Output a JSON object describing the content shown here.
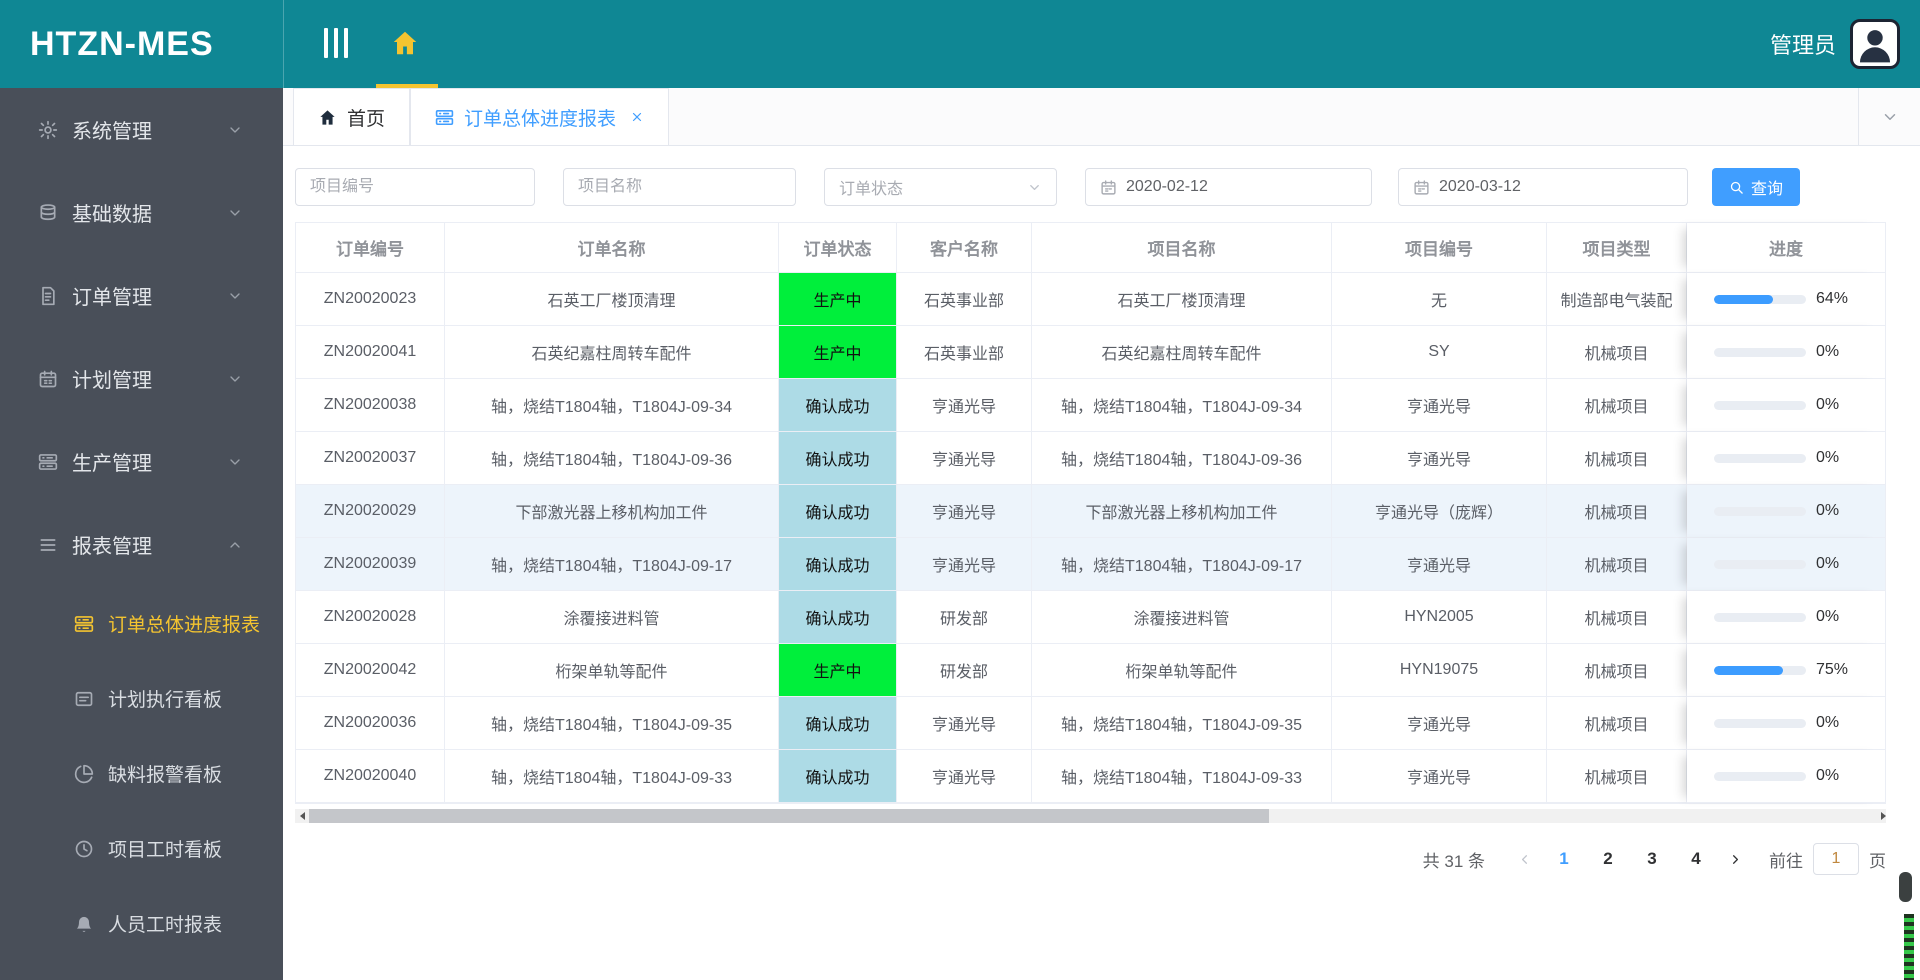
{
  "theme": {
    "teal": "#0f8794",
    "sidebar_bg": "#494f59",
    "accent_blue": "#409eff",
    "gold": "#f4c430",
    "status_green": "#00ef3b",
    "status_light_blue": "#addbe6",
    "progress_blue": "#3c9cff"
  },
  "header": {
    "logo": "HTZN-MES",
    "user": "管理员"
  },
  "sidebar": {
    "items": [
      {
        "label": "系统管理",
        "icon": "gear",
        "expanded": false
      },
      {
        "label": "基础数据",
        "icon": "database",
        "expanded": false
      },
      {
        "label": "订单管理",
        "icon": "document",
        "expanded": false
      },
      {
        "label": "计划管理",
        "icon": "calendar",
        "expanded": false
      },
      {
        "label": "生产管理",
        "icon": "server",
        "expanded": false
      },
      {
        "label": "报表管理",
        "icon": "list",
        "expanded": true
      }
    ],
    "submenu": [
      {
        "label": "订单总体进度报表",
        "icon": "server",
        "active": true
      },
      {
        "label": "计划执行看板",
        "icon": "board",
        "active": false
      },
      {
        "label": "缺料报警看板",
        "icon": "pie",
        "active": false
      },
      {
        "label": "项目工时看板",
        "icon": "clock",
        "active": false
      },
      {
        "label": "人员工时报表",
        "icon": "bell",
        "active": false
      }
    ]
  },
  "tabs": [
    {
      "label": "首页",
      "icon": "home",
      "active": false,
      "closable": false
    },
    {
      "label": "订单总体进度报表",
      "icon": "server",
      "active": true,
      "closable": true
    }
  ],
  "filters": {
    "project_no_placeholder": "项目编号",
    "project_name_placeholder": "项目名称",
    "order_status_placeholder": "订单状态",
    "date_from": "2020-02-12",
    "date_to": "2020-03-12",
    "search_label": "查询"
  },
  "table": {
    "columns": [
      "订单编号",
      "订单名称",
      "订单状态",
      "客户名称",
      "项目名称",
      "项目编号",
      "项目类型",
      "进度"
    ],
    "rows": [
      {
        "order_no": "ZN20020023",
        "order_name": "石英工厂楼顶清理",
        "status": "生产中",
        "status_type": "green",
        "customer": "石英事业部",
        "project_name": "石英工厂楼顶清理",
        "project_no": "无",
        "project_type": "制造部电气装配",
        "progress": 64,
        "highlight": false
      },
      {
        "order_no": "ZN20020041",
        "order_name": "石英纪嘉柱周转车配件",
        "status": "生产中",
        "status_type": "green",
        "customer": "石英事业部",
        "project_name": "石英纪嘉柱周转车配件",
        "project_no": "SY",
        "project_type": "机械项目",
        "progress": 0,
        "highlight": false
      },
      {
        "order_no": "ZN20020038",
        "order_name": "轴，烧结T1804轴，T1804J-09-34",
        "status": "确认成功",
        "status_type": "blue",
        "customer": "亨通光导",
        "project_name": "轴，烧结T1804轴，T1804J-09-34",
        "project_no": "亨通光导",
        "project_type": "机械项目",
        "progress": 0,
        "highlight": false
      },
      {
        "order_no": "ZN20020037",
        "order_name": "轴，烧结T1804轴，T1804J-09-36",
        "status": "确认成功",
        "status_type": "blue",
        "customer": "亨通光导",
        "project_name": "轴，烧结T1804轴，T1804J-09-36",
        "project_no": "亨通光导",
        "project_type": "机械项目",
        "progress": 0,
        "highlight": false
      },
      {
        "order_no": "ZN20020029",
        "order_name": "下部激光器上移机构加工件",
        "status": "确认成功",
        "status_type": "blue",
        "customer": "亨通光导",
        "project_name": "下部激光器上移机构加工件",
        "project_no": "亨通光导（庞辉）",
        "project_type": "机械项目",
        "progress": 0,
        "highlight": true
      },
      {
        "order_no": "ZN20020039",
        "order_name": "轴，烧结T1804轴，T1804J-09-17",
        "status": "确认成功",
        "status_type": "blue",
        "customer": "亨通光导",
        "project_name": "轴，烧结T1804轴，T1804J-09-17",
        "project_no": "亨通光导",
        "project_type": "机械项目",
        "progress": 0,
        "highlight": true
      },
      {
        "order_no": "ZN20020028",
        "order_name": "涂覆接进料管",
        "status": "确认成功",
        "status_type": "blue",
        "customer": "研发部",
        "project_name": "涂覆接进料管",
        "project_no": "HYN2005",
        "project_type": "机械项目",
        "progress": 0,
        "highlight": false
      },
      {
        "order_no": "ZN20020042",
        "order_name": "桁架单轨等配件",
        "status": "生产中",
        "status_type": "green",
        "customer": "研发部",
        "project_name": "桁架单轨等配件",
        "project_no": "HYN19075",
        "project_type": "机械项目",
        "progress": 75,
        "highlight": false
      },
      {
        "order_no": "ZN20020036",
        "order_name": "轴，烧结T1804轴，T1804J-09-35",
        "status": "确认成功",
        "status_type": "blue",
        "customer": "亨通光导",
        "project_name": "轴，烧结T1804轴，T1804J-09-35",
        "project_no": "亨通光导",
        "project_type": "机械项目",
        "progress": 0,
        "highlight": false
      },
      {
        "order_no": "ZN20020040",
        "order_name": "轴，烧结T1804轴，T1804J-09-33",
        "status": "确认成功",
        "status_type": "blue",
        "customer": "亨通光导",
        "project_name": "轴，烧结T1804轴，T1804J-09-33",
        "project_no": "亨通光导",
        "project_type": "机械项目",
        "progress": 0,
        "highlight": false
      }
    ]
  },
  "pagination": {
    "total_text": "共 31 条",
    "pages": [
      "1",
      "2",
      "3",
      "4"
    ],
    "active_page": "1",
    "goto_label": "前往",
    "goto_value": "1",
    "page_unit": "页"
  }
}
